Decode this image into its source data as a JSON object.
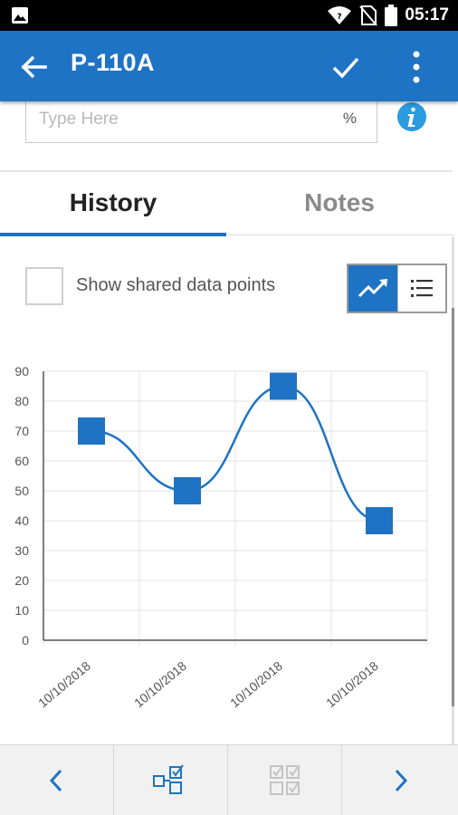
{
  "status_bar": {
    "time": "05:17",
    "icons": [
      "image-icon",
      "wifi-icon",
      "no-sim-icon",
      "battery-icon"
    ]
  },
  "app_bar": {
    "title": "P-110A",
    "icons": [
      "back-arrow-icon",
      "check-icon",
      "more-vert-icon"
    ]
  },
  "input": {
    "placeholder": "Type Here",
    "value": "",
    "unit": "%"
  },
  "tabs": [
    {
      "label": "History",
      "active": true
    },
    {
      "label": "Notes",
      "active": false
    }
  ],
  "shared_points": {
    "label": "Show shared data points",
    "checked": false
  },
  "view_toggle": {
    "options": [
      "chart-view-icon",
      "list-view-icon"
    ],
    "selected": "chart"
  },
  "colors": {
    "accent": "#1f73c4",
    "info": "#2b9be0"
  },
  "chart_data": {
    "type": "line",
    "x": [
      "10/10/2018",
      "10/10/2018",
      "10/10/2018",
      "10/10/2018"
    ],
    "series": [
      {
        "values": [
          70,
          50,
          85,
          40
        ]
      }
    ],
    "ylim": [
      0,
      90
    ],
    "yticks": [
      0,
      10,
      20,
      30,
      40,
      50,
      60,
      70,
      80,
      90
    ],
    "grid": true,
    "xlabel": "",
    "ylabel": "",
    "title": ""
  },
  "bottom_bar": {
    "buttons": [
      "prev-icon",
      "copy-checklist-icon",
      "checklist-grid-icon",
      "next-icon"
    ]
  }
}
